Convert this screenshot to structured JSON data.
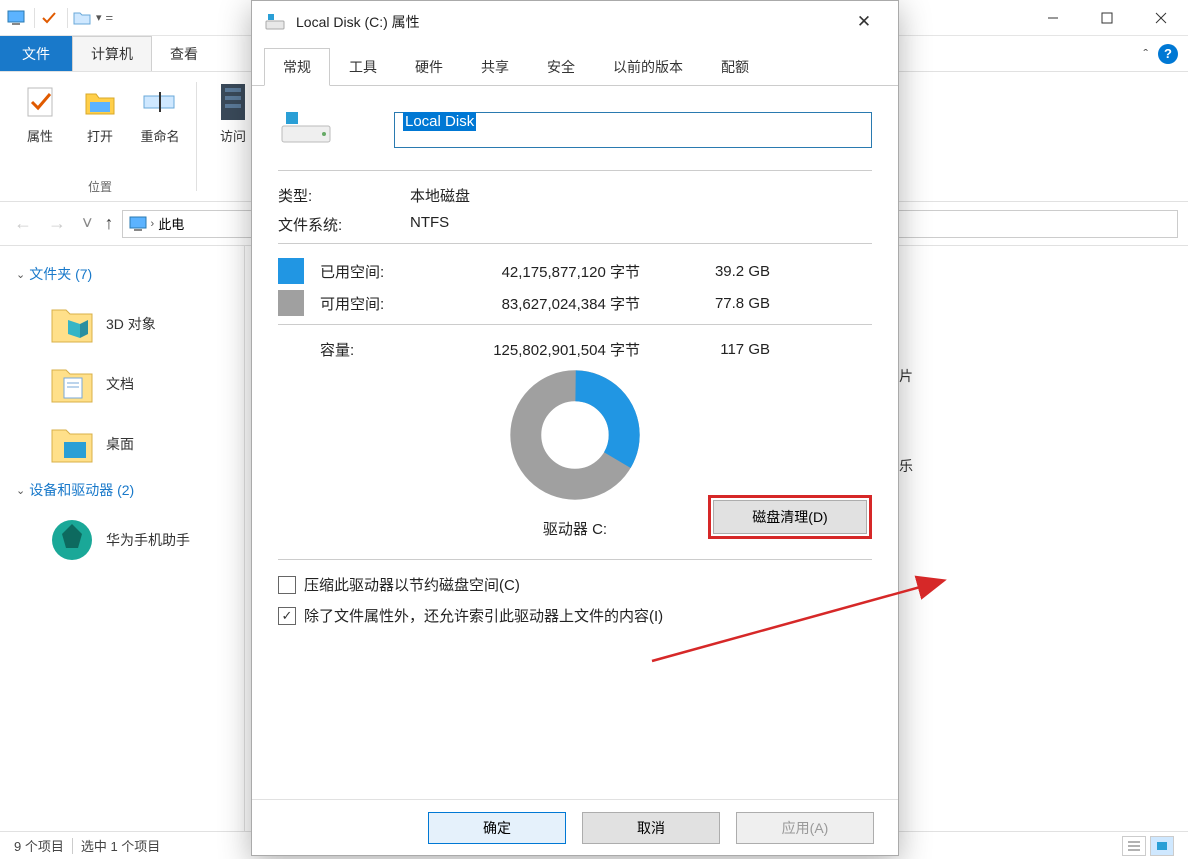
{
  "explorer": {
    "tabs": {
      "file": "文件",
      "computer": "计算机",
      "view": "查看"
    },
    "ribbon": {
      "properties": "属性",
      "open": "打开",
      "rename": "重命名",
      "access": "访问",
      "group_loc": "位置"
    },
    "nav": {
      "breadcrumb": "此电"
    },
    "tree": {
      "folders_hdr": "文件夹 (7)",
      "items": [
        "3D 对象",
        "文档",
        "桌面"
      ],
      "devices_hdr": "设备和驱动器 (2)",
      "dev0": "华为手机助手"
    },
    "content": {
      "pics": "图片",
      "music": "音乐"
    },
    "status": {
      "count": "9 个项目",
      "selected": "选中 1 个项目"
    }
  },
  "dialog": {
    "title": "Local Disk (C:) 属性",
    "tabs": [
      "常规",
      "工具",
      "硬件",
      "共享",
      "安全",
      "以前的版本",
      "配额"
    ],
    "name_value": "Local Disk",
    "type_k": "类型:",
    "type_v": "本地磁盘",
    "fs_k": "文件系统:",
    "fs_v": "NTFS",
    "used_k": "已用空间:",
    "used_bytes": "42,175,877,120 字节",
    "used_gb": "39.2 GB",
    "free_k": "可用空间:",
    "free_bytes": "83,627,024,384 字节",
    "free_gb": "77.8 GB",
    "cap_k": "容量:",
    "cap_bytes": "125,802,901,504 字节",
    "cap_gb": "117 GB",
    "drive_label": "驱动器 C:",
    "cleanup": "磁盘清理(D)",
    "chk1": "压缩此驱动器以节约磁盘空间(C)",
    "chk2": "除了文件属性外，还允许索引此驱动器上文件的内容(I)",
    "ok": "确定",
    "cancel": "取消",
    "apply": "应用(A)"
  },
  "chart_data": {
    "type": "pie",
    "title": "",
    "categories": [
      "已用空间",
      "可用空间"
    ],
    "values": [
      39.2,
      77.8
    ],
    "colors": [
      "#2196e3",
      "#a0a0a0"
    ],
    "unit": "GB"
  }
}
